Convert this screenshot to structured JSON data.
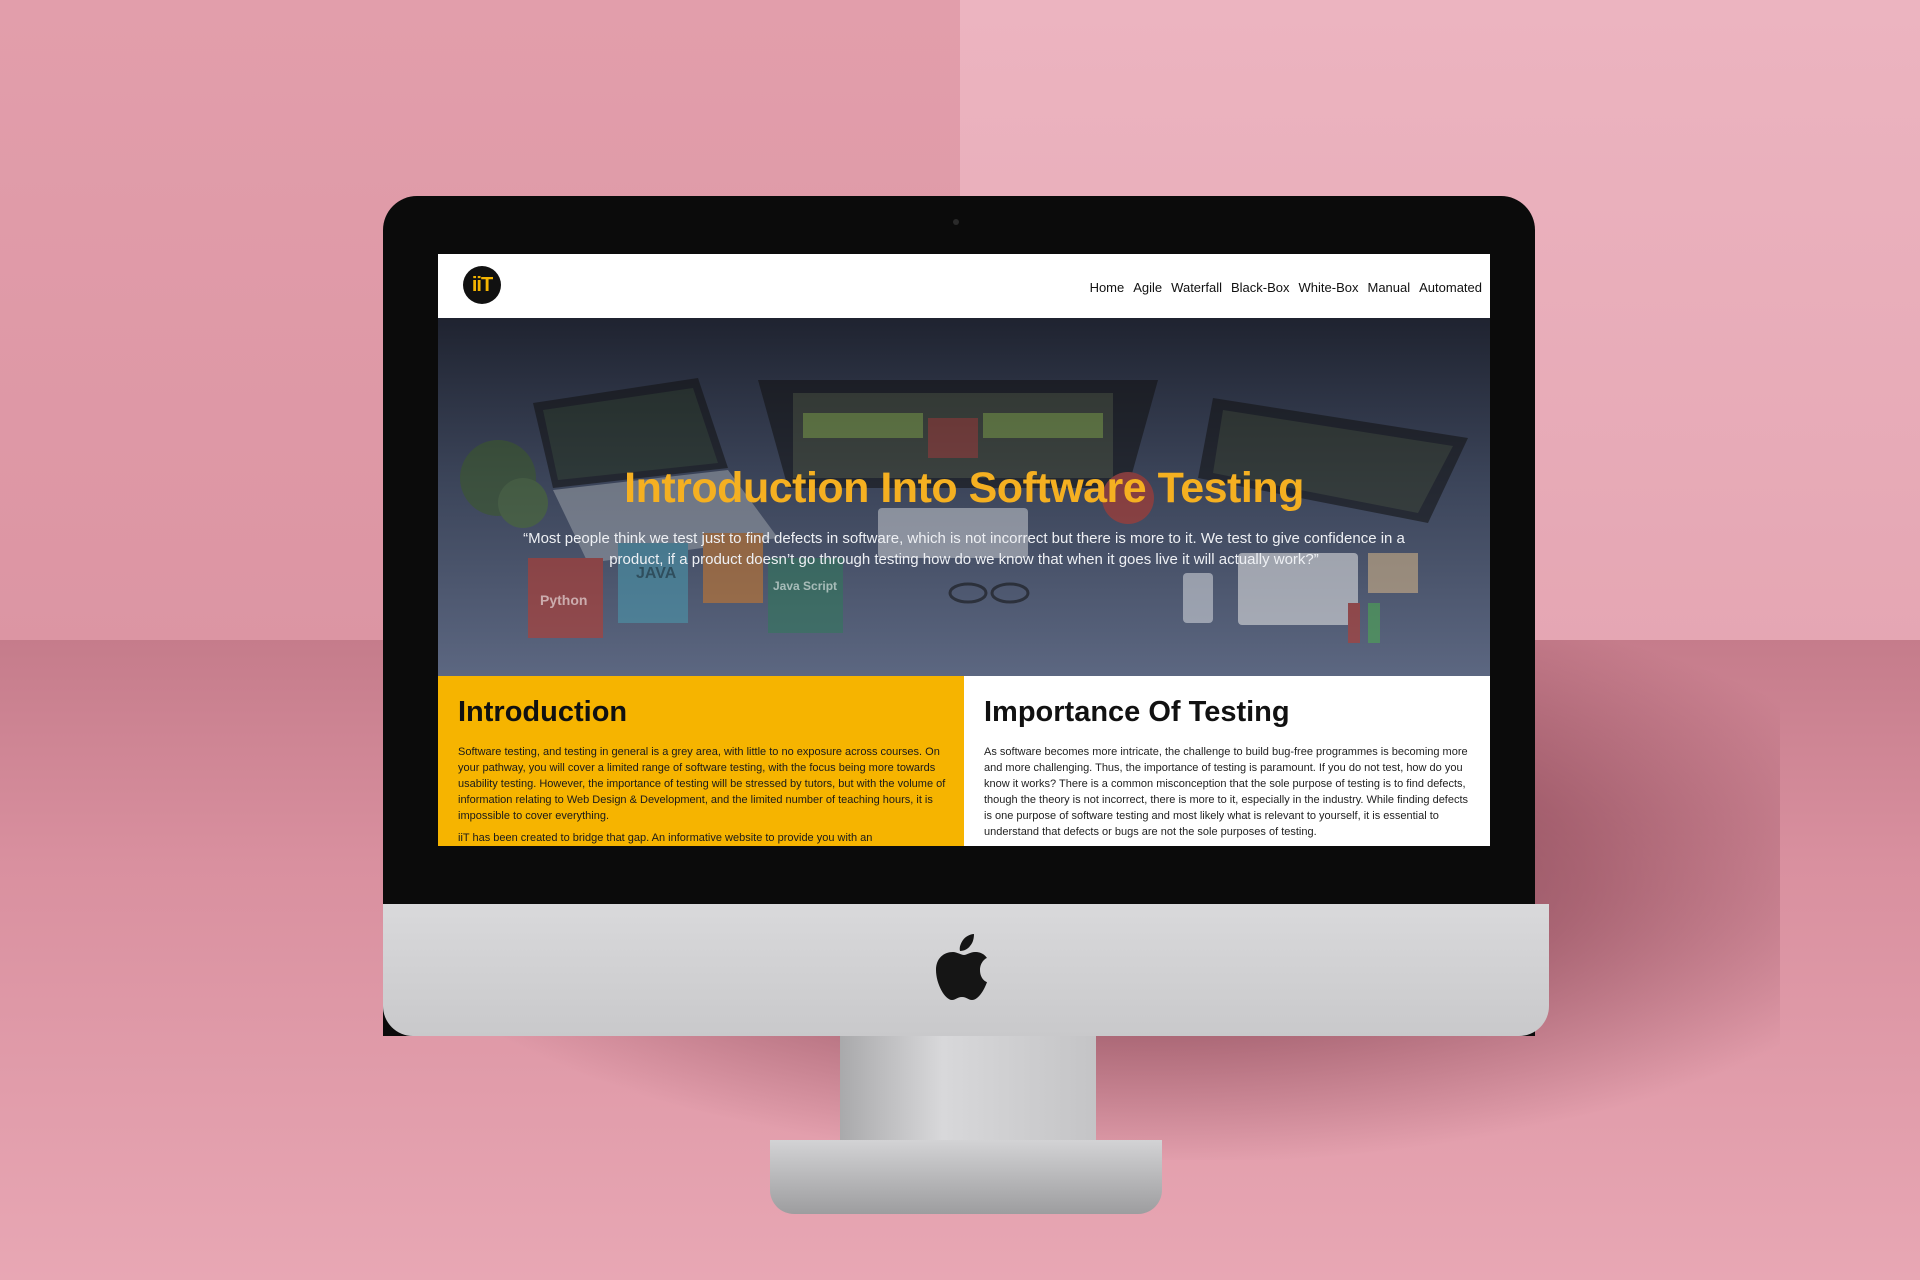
{
  "site": {
    "logo_text": "iiT",
    "nav": [
      "Home",
      "Agile",
      "Waterfall",
      "Black-Box",
      "White-Box",
      "Manual",
      "Automated"
    ]
  },
  "hero": {
    "title": "Introduction Into Software Testing",
    "quote": "“Most people think we test just to find defects in software, which is not incorrect but there is more to it. We test to give confidence in a product, if a product doesn’t go through testing how do we know that when it goes live it will actually work?”",
    "book_labels": [
      "Python",
      "JAVA",
      "Java Script"
    ]
  },
  "intro": {
    "heading": "Introduction",
    "paragraphs": [
      "Software testing, and testing in general is a grey area, with little to no exposure across courses. On your pathway, you will cover a limited range of software testing, with the focus being more towards usability testing. However, the importance of testing will be stressed by tutors, but with the volume of information relating to Web Design & Development, and the limited number of teaching hours, it is impossible to cover everything.",
      "iiT has been created to bridge that gap. An informative website to provide you with an"
    ]
  },
  "importance": {
    "heading": "Importance Of Testing",
    "paragraphs": [
      "As software becomes more intricate, the challenge to build bug-free programmes is becoming more and more challenging. Thus, the importance of testing is paramount. If you do not test, how do you know it works? There is a common misconception that the sole purpose of testing is to find defects, though the theory is not incorrect, there is more to it, especially in the industry. While finding defects is one purpose of software testing and most likely what is relevant to yourself, it is essential to understand that defects or bugs are not the sole purposes of testing."
    ]
  },
  "colors": {
    "accent": "#f6b400",
    "background": "#e6a9b5"
  }
}
